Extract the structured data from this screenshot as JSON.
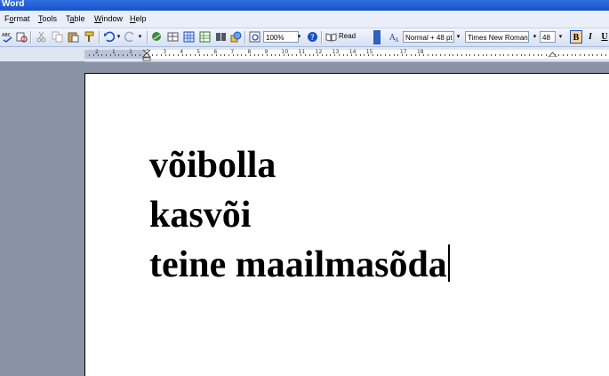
{
  "window": {
    "title": "Word"
  },
  "menu": [
    {
      "label": "Format",
      "key": "o"
    },
    {
      "label": "Tools",
      "key": "T"
    },
    {
      "label": "Table",
      "key": "a"
    },
    {
      "label": "Window",
      "key": "W"
    },
    {
      "label": "Help",
      "key": "H"
    }
  ],
  "toolbar": {
    "zoom": "100%",
    "read_label": "Read",
    "style": "Normal + 48 pt",
    "font": "Times New Roman",
    "font_size": "48",
    "bold_label": "B",
    "italic_label": "I",
    "underline_label": "U"
  },
  "ruler": {
    "numbers": [
      "2",
      "1",
      "1",
      "2",
      "3",
      "4",
      "5",
      "6",
      "7",
      "8",
      "9",
      "10",
      "11",
      "12",
      "13",
      "14",
      "15",
      "17",
      "18"
    ]
  },
  "document": {
    "lines": [
      "võibolla",
      "kasvõi",
      "teine maailmasõda"
    ]
  }
}
